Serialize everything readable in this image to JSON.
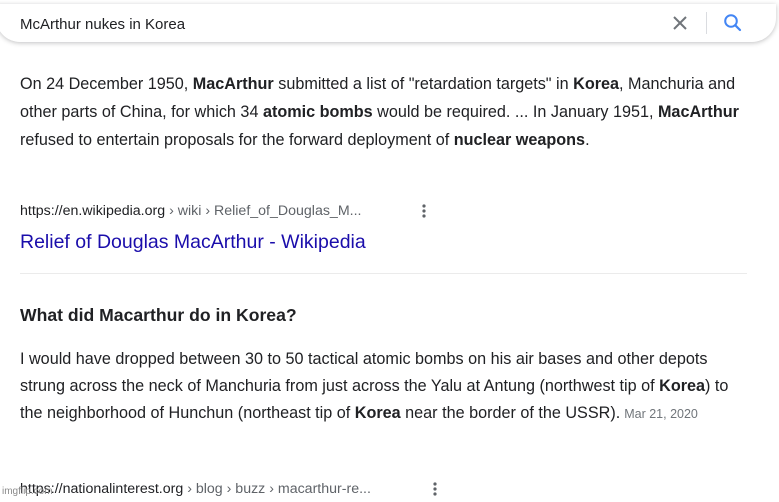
{
  "search": {
    "query": "McArthur nukes in Korea"
  },
  "snippet": {
    "t1": "On 24 December 1950, ",
    "b1": "MacArthur",
    "t2": " submitted a list of \"retardation targets\" in ",
    "b2": "Korea",
    "t3": ", Manchuria and other parts of China, for which 34 ",
    "b3": "atomic bombs",
    "t4": " would be required. ... In January 1951, ",
    "b4": "MacArthur",
    "t5": " refused to entertain proposals for the forward deployment of ",
    "b5": "nuclear weapons",
    "t6": "."
  },
  "result1": {
    "domain": "https://en.wikipedia.org",
    "path": " › wiki › Relief_of_Douglas_M...",
    "title": "Relief of Douglas MacArthur - Wikipedia"
  },
  "question": "What did Macarthur do in Korea?",
  "answer": {
    "t1": "I would have dropped between 30 to 50 tactical atomic bombs on his air bases and other depots strung across the neck of Manchuria from just across the Yalu at Antung (northwest tip of ",
    "b1": "Korea",
    "t2": ") to the neighborhood of Hunchun (northeast tip of ",
    "b2": "Korea",
    "t3": " near the border of the USSR).",
    "date": "Mar 21, 2020"
  },
  "result2": {
    "domain": "https://nationalinterest.org",
    "path": " › blog › buzz › macarthur-re..."
  },
  "watermark": "imgflip.com",
  "colors": {
    "link": "#1a0dab",
    "text": "#202124",
    "search_icon": "#4285f4",
    "muted": "#70757a"
  }
}
